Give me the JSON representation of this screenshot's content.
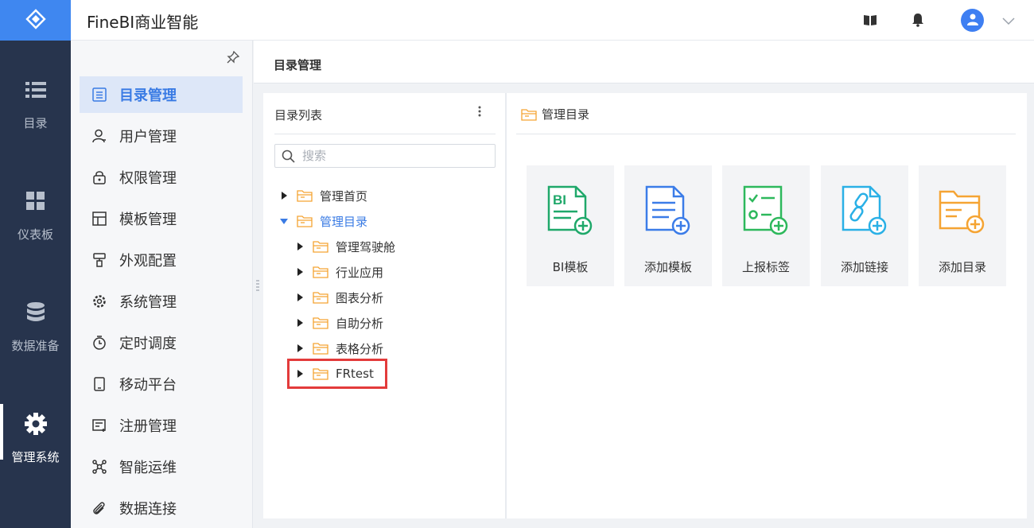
{
  "app": {
    "title": "FineBI商业智能",
    "avatar_name": ""
  },
  "rail": {
    "items": [
      {
        "label": "目录",
        "icon": "list-icon"
      },
      {
        "label": "仪表板",
        "icon": "dashboard-icon"
      },
      {
        "label": "数据准备",
        "icon": "database-icon"
      },
      {
        "label": "管理系统",
        "icon": "gear-icon"
      }
    ]
  },
  "menu": {
    "items": [
      {
        "label": "目录管理",
        "icon": "catalog-icon",
        "active": true
      },
      {
        "label": "用户管理",
        "icon": "user-icon"
      },
      {
        "label": "权限管理",
        "icon": "lock-icon"
      },
      {
        "label": "模板管理",
        "icon": "template-icon"
      },
      {
        "label": "外观配置",
        "icon": "brush-icon"
      },
      {
        "label": "系统管理",
        "icon": "settings-icon"
      },
      {
        "label": "定时调度",
        "icon": "timer-icon"
      },
      {
        "label": "移动平台",
        "icon": "mobile-icon"
      },
      {
        "label": "注册管理",
        "icon": "register-icon"
      },
      {
        "label": "智能运维",
        "icon": "network-icon"
      },
      {
        "label": "数据连接",
        "icon": "paperclip-icon"
      }
    ]
  },
  "page": {
    "title": "目录管理"
  },
  "catalog_list": {
    "title": "目录列表",
    "search_placeholder": "搜索",
    "tree": [
      {
        "label": "管理首页",
        "level": 0,
        "expanded": false
      },
      {
        "label": "管理目录",
        "level": 0,
        "expanded": true
      },
      {
        "label": "管理驾驶舱",
        "level": 1,
        "expanded": false
      },
      {
        "label": "行业应用",
        "level": 1,
        "expanded": false
      },
      {
        "label": "图表分析",
        "level": 1,
        "expanded": false
      },
      {
        "label": "自助分析",
        "level": 1,
        "expanded": false
      },
      {
        "label": "表格分析",
        "level": 1,
        "expanded": false
      },
      {
        "label": "FRtest",
        "level": 1,
        "expanded": false,
        "highlighted": true
      }
    ]
  },
  "manage_panel": {
    "title": "管理目录",
    "actions": [
      {
        "label": "BI模板",
        "icon": "bi-template-add-icon",
        "color": "#1fa86a"
      },
      {
        "label": "添加模板",
        "icon": "template-add-icon",
        "color": "#3b7ce8"
      },
      {
        "label": "上报标签",
        "icon": "report-tag-add-icon",
        "color": "#2db85c"
      },
      {
        "label": "添加链接",
        "icon": "link-add-icon",
        "color": "#2ab0e6"
      },
      {
        "label": "添加目录",
        "icon": "folder-add-icon",
        "color": "#f5a433"
      }
    ]
  },
  "colors": {
    "rail_bg": "#27344d",
    "accent": "#3a7be4",
    "folder": "#f5a433",
    "highlight": "#e33b3b"
  }
}
